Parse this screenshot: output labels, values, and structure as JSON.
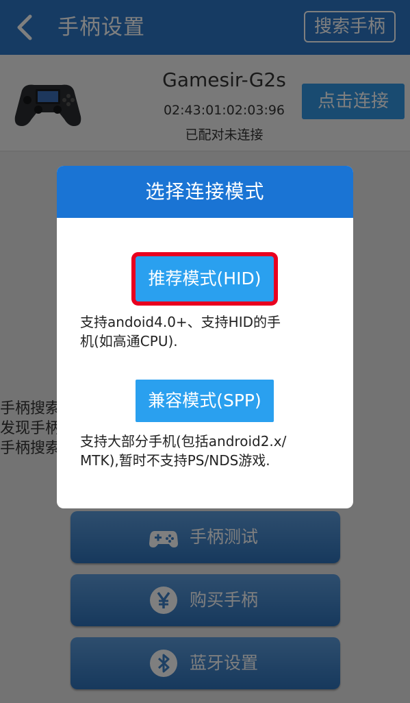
{
  "header": {
    "title": "手柄设置",
    "search_label": "搜索手柄"
  },
  "device": {
    "name": "Gamesir-G2s",
    "mac": "02:43:01:02:03:96",
    "status": "已配对未连接",
    "connect_label": "点击连接"
  },
  "background_text": [
    "手柄搜索",
    "发现手柄",
    "手柄搜索"
  ],
  "actions": [
    {
      "label": "手柄测试",
      "icon": "gamepad-icon"
    },
    {
      "label": "购买手柄",
      "icon": "yen-icon"
    },
    {
      "label": "蓝牙设置",
      "icon": "bluetooth-icon"
    }
  ],
  "dialog": {
    "title": "选择连接模式",
    "hid_label": "推荐模式(HID)",
    "hid_desc_line1": "支持andoid4.0+、支持HID的手",
    "hid_desc_line2": "机(如高通CPU).",
    "spp_label": "兼容模式(SPP)",
    "spp_desc_line1": "支持大部分手机(包括android2.x/",
    "spp_desc_line2": "MTK),暂时不支持PS/NDS游戏."
  },
  "colors": {
    "header_bg": "#2c77c6",
    "dialog_header_bg": "#1a74d4",
    "mode_button": "#2aa0ef",
    "highlight_border": "#e8001f"
  }
}
